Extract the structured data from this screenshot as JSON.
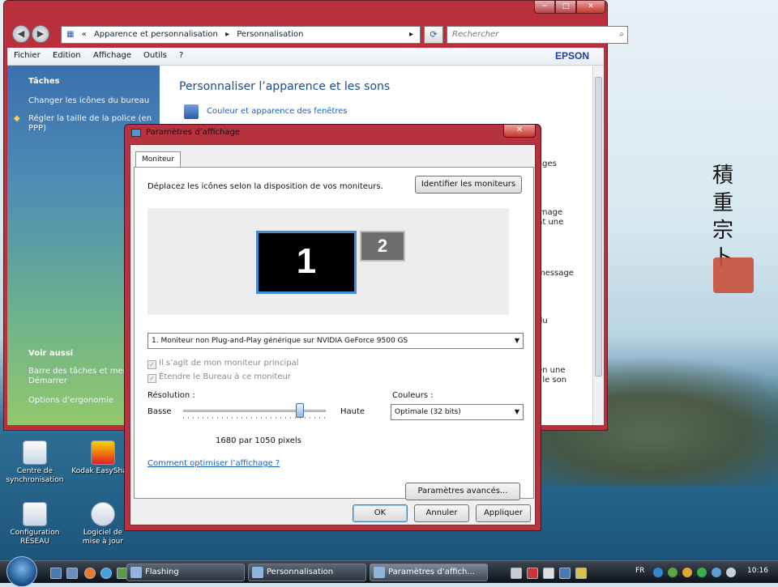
{
  "desktop": {
    "icons": [
      {
        "label": "Centre de\nsynchronisation"
      },
      {
        "label": "Kodak EasyShare"
      },
      {
        "label": "Configuration\nRÉSEAU"
      },
      {
        "label": "Logiciel de\nmise à jour"
      }
    ],
    "calligraphy": "積\n重\n宗\n卜"
  },
  "explorer": {
    "breadcrumb": [
      "«",
      "Apparence et personnalisation",
      "▸",
      "Personnalisation",
      "▸"
    ],
    "search_placeholder": "Rechercher",
    "menu": [
      "Fichier",
      "Edition",
      "Affichage",
      "Outils",
      "?"
    ],
    "brand": "EPSON",
    "sidebar": {
      "tasks_heading": "Tâches",
      "tasks": [
        "Changer les icônes du bureau",
        "Régler la taille de la police (en PPP)"
      ],
      "see_also_heading": "Voir aussi",
      "see_also": [
        "Barre des tâches et menu Démarrer",
        "Options d’ergonomie"
      ]
    },
    "content_title": "Personnaliser l’apparence et les sons",
    "content_links": [
      "Couleur et apparence des fenêtres"
    ],
    "partial_texts": [
      "ages",
      "image\nnt une",
      "message",
      "du",
      "en une\n, le son"
    ]
  },
  "dialog": {
    "title": "Paramètres d’affichage",
    "tab": "Moniteur",
    "instruction": "Déplacez les icônes selon la disposition de vos moniteurs.",
    "identify_button": "Identifier les moniteurs",
    "monitor1_label": "1",
    "monitor2_label": "2",
    "monitor_select": "1. Moniteur non Plug-and-Play générique sur NVIDIA GeForce 9500 GS",
    "checkbox_primary": "Il s’agit de mon moniteur principal",
    "checkbox_extend": "Étendre le Bureau à ce moniteur",
    "resolution_label": "Résolution :",
    "low_label": "Basse",
    "high_label": "Haute",
    "resolution_value": "1680 par 1050 pixels",
    "colors_label": "Couleurs :",
    "colors_select": "Optimale (32 bits)",
    "help_link": "Comment optimiser l’affichage ?",
    "advanced_button": "Paramètres avancés...",
    "ok_button": "OK",
    "cancel_button": "Annuler",
    "apply_button": "Appliquer",
    "slider_level": 0.82
  },
  "taskbar": {
    "tasks": [
      "Flashing",
      "Personnalisation",
      "Paramètres d’affich..."
    ],
    "language": "FR",
    "clock": "10:16"
  },
  "colors": {
    "window_frame": "#b9303c",
    "link": "#1c60c0",
    "monitor_highlight": "#3d8fd8"
  }
}
